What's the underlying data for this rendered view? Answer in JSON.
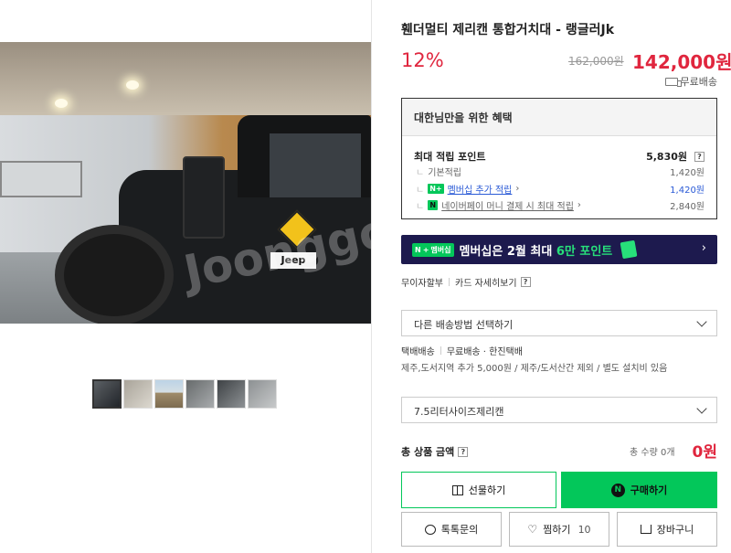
{
  "product": {
    "title": "휀더멀티 제리캔 통합거치대 - 랭글러Jk",
    "discount": "12%",
    "original_price": "162,000원",
    "sale_price": "142,000원",
    "shipping_badge": "무료배송",
    "photo_watermark": "Joonggo"
  },
  "benefit": {
    "heading": "대한님만을 위한 혜택",
    "max_points_label": "최대 적립 포인트",
    "max_points_value": "5,830원",
    "help_glyph": "?",
    "rows": [
      {
        "label": "기본적립",
        "value": "1,420원"
      },
      {
        "label": "멤버십 추가 적립",
        "value": "1,420원",
        "badge": "N+"
      },
      {
        "label": "네이버페이 머니 결제 시 최대 적립",
        "value": "2,840원",
        "badge": "N"
      }
    ],
    "tree_glyph": "ㄴ"
  },
  "banner": {
    "tag_n": "N",
    "tag_plus": "+",
    "tag_text": "멤버십",
    "text_prefix": "멤버십은 2월 최대 ",
    "text_highlight": "6만 포인트",
    "arrow": "›"
  },
  "pay_links": {
    "interest_free": "무이자할부",
    "card_benefits": "카드 자세히보기"
  },
  "shipping": {
    "select_placeholder": "다른 배송방법 선택하기",
    "method": "택배배송",
    "fee": "무료배송 · 한진택배",
    "note": "제주,도서지역 추가 5,000원 / 제주/도서산간 제외 / 별도 설치비 있음"
  },
  "option": {
    "selected": "7.5리터사이즈제리캔"
  },
  "total": {
    "label": "총 상품 금액",
    "qty": "총 수량 0개",
    "price": "0원"
  },
  "buttons": {
    "gift": "선물하기",
    "buy": "구매하기",
    "buy_glyph": "N",
    "chat": "톡톡문의",
    "like": "찜하기",
    "like_count": "10",
    "cart": "장바구니"
  },
  "icons": {
    "truck": "truck-icon",
    "gift": "gift-icon",
    "chat": "chat-icon",
    "heart": "heart-icon",
    "cart": "cart-icon"
  },
  "colors": {
    "accent_red": "#e0263e",
    "naver_green": "#03c75a",
    "banner_bg": "#1d1a4e",
    "link_blue": "#2a5ad6"
  }
}
